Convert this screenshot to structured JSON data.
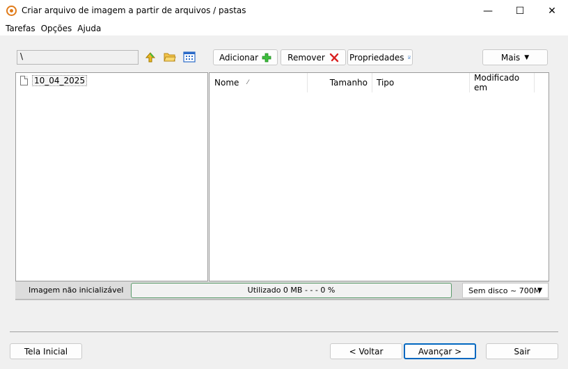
{
  "window": {
    "title": "Criar arquivo de imagem a partir de arquivos / pastas",
    "minimize": "—",
    "maximize": "☐",
    "close": "✕"
  },
  "menu": [
    "Tarefas",
    "Opções",
    "Ajuda"
  ],
  "toolbar": {
    "path": "\\",
    "add_label": "Adicionar",
    "remove_label": "Remover",
    "properties_label": "Propriedades",
    "more_label": "Mais"
  },
  "tree": {
    "items": [
      {
        "label": "10_04_2025"
      }
    ]
  },
  "list": {
    "columns": [
      "Nome",
      "Tamanho",
      "Tipo",
      "Modificado em"
    ],
    "sort_indicator": "⁄",
    "rows": []
  },
  "status": {
    "boot_label": "Imagem não inicializável",
    "usage_text": "Utilizado  0 MB    - - -  0 %",
    "usage_percent": 0,
    "disk_selected": "Sem disco ~ 700M"
  },
  "footer": {
    "home_label": "Tela Inicial",
    "back_label": "< Voltar",
    "next_label": "Avançar >",
    "exit_label": "Sair"
  },
  "colors": {
    "accent": "#0067c0",
    "progress": "#06b025",
    "add_icon": "#3dbd3d",
    "remove_icon": "#d92020"
  }
}
